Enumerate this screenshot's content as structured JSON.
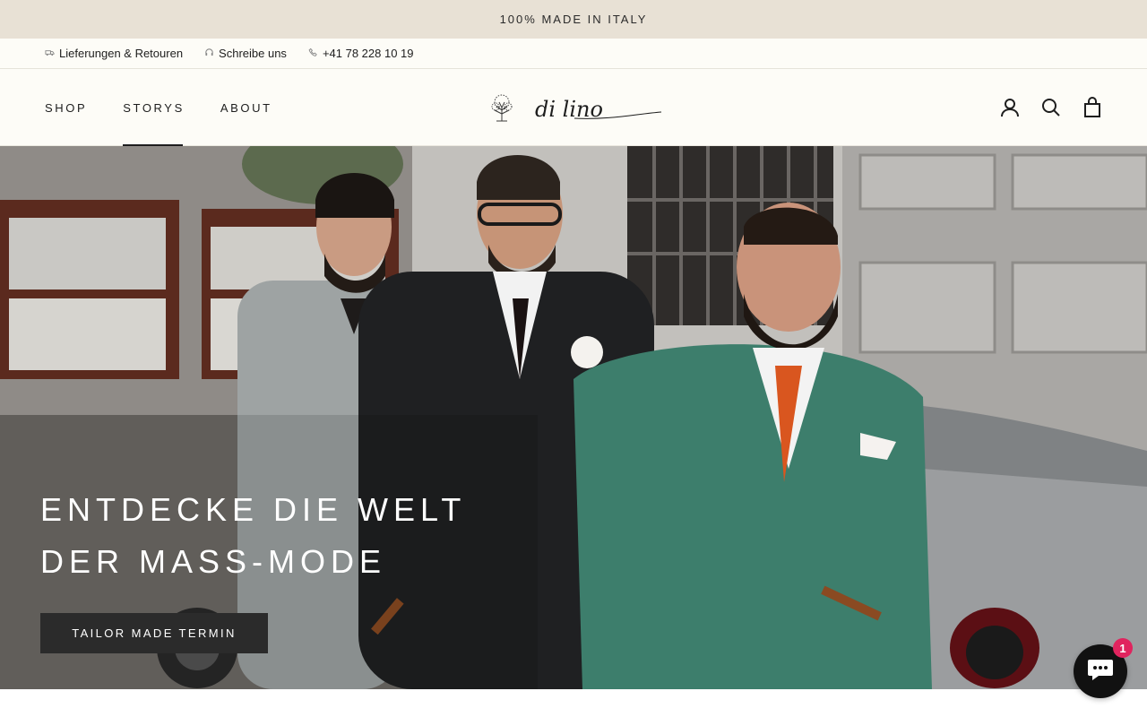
{
  "announcement": {
    "text": "100% MADE IN ITALY"
  },
  "infobar": {
    "items": [
      {
        "label": "Lieferungen & Retouren",
        "icon": "truck-icon"
      },
      {
        "label": "Schreibe uns",
        "icon": "headset-icon"
      },
      {
        "label": "+41 78 228 10 19",
        "icon": "phone-icon"
      }
    ]
  },
  "nav": {
    "items": [
      {
        "label": "SHOP",
        "active": false
      },
      {
        "label": "STORYS",
        "active": true
      },
      {
        "label": "ABOUT",
        "active": false
      }
    ]
  },
  "logo": {
    "wordmark": "di lino",
    "icon": "tree-icon"
  },
  "header_icons": [
    "account-icon",
    "search-icon",
    "cart-icon"
  ],
  "hero": {
    "title_line1": "ENTDECKE DIE WELT",
    "title_line2": "DER MASS-MODE",
    "button_label": "TAILOR MADE TERMIN"
  },
  "chat": {
    "badge_count": "1",
    "icon": "chat-icon"
  },
  "colors": {
    "announcement_bg": "#e8e1d5",
    "header_bg": "#fdfcf7",
    "button_bg": "#2b2b2b",
    "badge": "#e0245e"
  }
}
